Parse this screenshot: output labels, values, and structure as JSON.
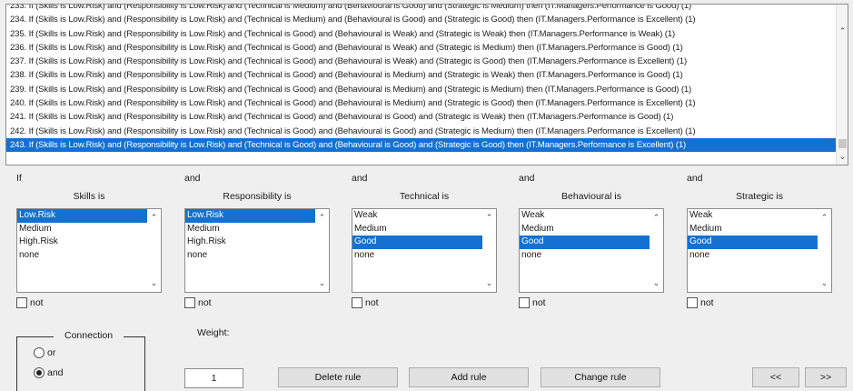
{
  "rules": [
    "233. If (Skills is Low.Risk) and (Responsibility is Low.Risk) and (Technical is Medium) and (Behavioural is Good) and (Strategic is Medium) then (IT.Managers.Performance is Good) (1)",
    "234. If (Skills is Low.Risk) and (Responsibility is Low.Risk) and (Technical is Medium) and (Behavioural is Good) and (Strategic is Good) then (IT.Managers.Performance is Excellent) (1)",
    "235. If (Skills is Low.Risk) and (Responsibility is Low.Risk) and (Technical is Good) and (Behavioural is Weak) and (Strategic is Weak) then (IT.Managers.Performance is Weak) (1)",
    "236. If (Skills is Low.Risk) and (Responsibility is Low.Risk) and (Technical is Good) and (Behavioural is Weak) and (Strategic is Medium) then (IT.Managers.Performance is Good) (1)",
    "237. If (Skills is Low.Risk) and (Responsibility is Low.Risk) and (Technical is Good) and (Behavioural is Weak) and (Strategic is Good) then (IT.Managers.Performance is Excellent) (1)",
    "238. If (Skills is Low.Risk) and (Responsibility is Low.Risk) and (Technical is Good) and (Behavioural is Medium) and (Strategic is Weak) then (IT.Managers.Performance is Good) (1)",
    "239. If (Skills is Low.Risk) and (Responsibility is Low.Risk) and (Technical is Good) and (Behavioural is Medium) and (Strategic is Medium) then (IT.Managers.Performance is Good) (1)",
    "240. If (Skills is Low.Risk) and (Responsibility is Low.Risk) and (Technical is Good) and (Behavioural is Medium) and (Strategic is Good) then (IT.Managers.Performance is Excellent) (1)",
    "241. If (Skills is Low.Risk) and (Responsibility is Low.Risk) and (Technical is Good) and (Behavioural is Good) and (Strategic is Weak) then (IT.Managers.Performance is Good) (1)",
    "242. If (Skills is Low.Risk) and (Responsibility is Low.Risk) and (Technical is Good) and (Behavioural is Good) and (Strategic is Medium) then (IT.Managers.Performance is Excellent) (1)",
    "243. If (Skills is Low.Risk) and (Responsibility is Low.Risk) and (Technical is Good) and (Behavioural is Good) and (Strategic is Good) then (IT.Managers.Performance is Excellent) (1)"
  ],
  "selected_rule": 10,
  "columns": [
    {
      "conj": "If",
      "name": "Skills is",
      "options": [
        "Low.Risk",
        "Medium",
        "High.Risk",
        "none"
      ],
      "selected": 0,
      "not_label": "not"
    },
    {
      "conj": "and",
      "name": "Responsibility is",
      "options": [
        "Low.Risk",
        "Medium",
        "High.Risk",
        "none"
      ],
      "selected": 0,
      "not_label": "not"
    },
    {
      "conj": "and",
      "name": "Technical is",
      "options": [
        "Weak",
        "Medium",
        "Good",
        "none"
      ],
      "selected": 2,
      "not_label": "not"
    },
    {
      "conj": "and",
      "name": "Behavioural is",
      "options": [
        "Weak",
        "Medium",
        "Good",
        "none"
      ],
      "selected": 2,
      "not_label": "not"
    },
    {
      "conj": "and",
      "name": "Strategic is",
      "options": [
        "Weak",
        "Medium",
        "Good",
        "none"
      ],
      "selected": 2,
      "not_label": "not"
    }
  ],
  "connection": {
    "title": "Connection",
    "or_label": "or",
    "and_label": "and",
    "selected": "and"
  },
  "weight": {
    "label": "Weight:",
    "value": "1"
  },
  "buttons": {
    "delete": "Delete rule",
    "add": "Add rule",
    "change": "Change rule",
    "prev": "<<",
    "next": ">>"
  },
  "colors": {
    "selection": "#1471d2",
    "background": "#efefef"
  }
}
